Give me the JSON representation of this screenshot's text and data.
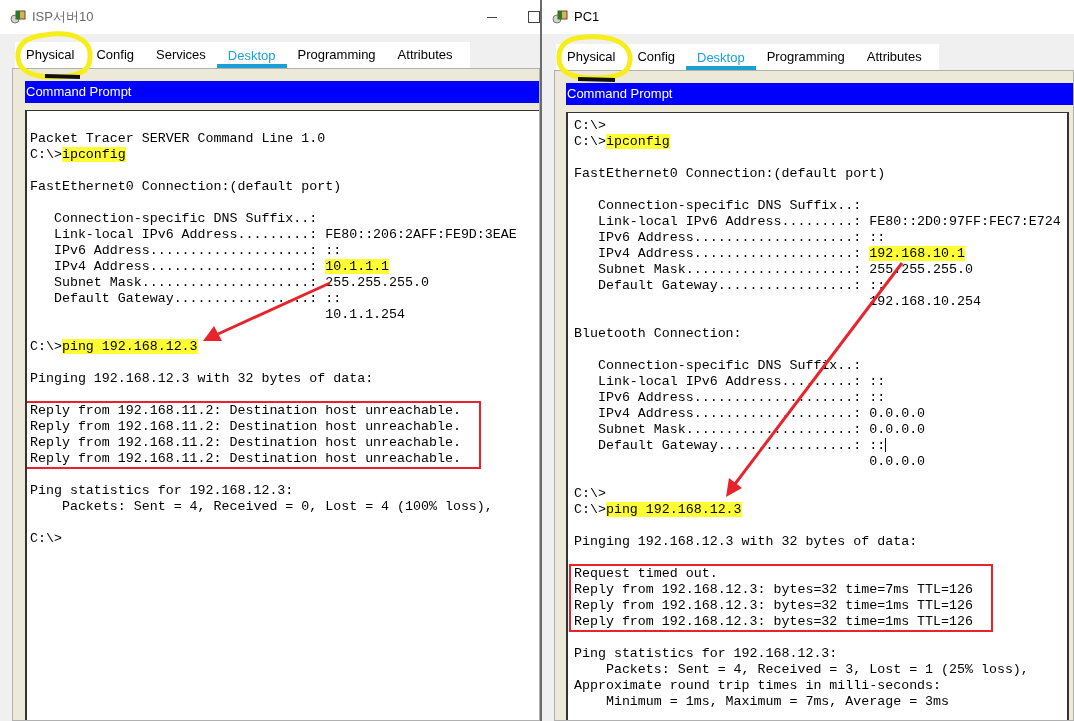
{
  "windows": [
    {
      "title": "ISP서버10",
      "active": false,
      "controls": true,
      "tabs": [
        {
          "label": "Physical",
          "selected": false
        },
        {
          "label": "Config",
          "selected": false
        },
        {
          "label": "Services",
          "selected": false
        },
        {
          "label": "Desktop",
          "selected": true
        },
        {
          "label": "Programming",
          "selected": false
        },
        {
          "label": "Attributes",
          "selected": false
        }
      ],
      "panel_title": "Command Prompt",
      "terminal": {
        "blocks": [
          {
            "boxed": false,
            "lines": [
              {
                "text": "Packet Tracer SERVER Command Line 1.0"
              },
              {
                "text": "C:\\>",
                "highlight": "ipconfig"
              }
            ]
          },
          {
            "boxed": false,
            "lines": [
              {
                "text": "FastEthernet0 Connection:(default port)"
              }
            ]
          },
          {
            "boxed": false,
            "lines": [
              {
                "text": "   Connection-specific DNS Suffix..:"
              },
              {
                "text": "   Link-local IPv6 Address.........: FE80::206:2AFF:FE9D:3EAE"
              },
              {
                "text": "   IPv6 Address....................: ::"
              },
              {
                "text": "   IPv4 Address....................: ",
                "highlight": "10.1.1.1"
              },
              {
                "text": "   Subnet Mask.....................: 255.255.255.0"
              },
              {
                "text": "   Default Gateway.................: ::"
              },
              {
                "text": "                                     10.1.1.254"
              }
            ]
          },
          {
            "boxed": false,
            "lines": [
              {
                "text": "C:\\>",
                "highlight": "ping 192.168.12.3"
              }
            ]
          },
          {
            "boxed": false,
            "lines": [
              {
                "text": "Pinging 192.168.12.3 with 32 bytes of data:"
              }
            ]
          },
          {
            "boxed": true,
            "lines": [
              {
                "text": "Reply from 192.168.11.2: Destination host unreachable."
              },
              {
                "text": "Reply from 192.168.11.2: Destination host unreachable."
              },
              {
                "text": "Reply from 192.168.11.2: Destination host unreachable."
              },
              {
                "text": "Reply from 192.168.11.2: Destination host unreachable."
              }
            ]
          },
          {
            "boxed": false,
            "lines": [
              {
                "text": "Ping statistics for 192.168.12.3:"
              },
              {
                "text": "    Packets: Sent = 4, Received = 0, Lost = 4 (100% loss),"
              }
            ]
          },
          {
            "boxed": false,
            "lines": [
              {
                "text": "C:\\>"
              }
            ]
          }
        ]
      }
    },
    {
      "title": "PC1",
      "active": true,
      "controls": false,
      "tabs": [
        {
          "label": "Physical",
          "selected": false
        },
        {
          "label": "Config",
          "selected": false
        },
        {
          "label": "Desktop",
          "selected": true
        },
        {
          "label": "Programming",
          "selected": false
        },
        {
          "label": "Attributes",
          "selected": false
        }
      ],
      "panel_title": "Command Prompt",
      "terminal": {
        "blocks": [
          {
            "boxed": false,
            "lines": [
              {
                "text": "C:\\>"
              },
              {
                "text": "C:\\>",
                "highlight": "ipconfig"
              }
            ]
          },
          {
            "boxed": false,
            "lines": [
              {
                "text": "FastEthernet0 Connection:(default port)"
              }
            ]
          },
          {
            "boxed": false,
            "lines": [
              {
                "text": "   Connection-specific DNS Suffix..:"
              },
              {
                "text": "   Link-local IPv6 Address.........: FE80::2D0:97FF:FEC7:E724"
              },
              {
                "text": "   IPv6 Address....................: ::"
              },
              {
                "text": "   IPv4 Address....................: ",
                "highlight": "192.168.10.1"
              },
              {
                "text": "   Subnet Mask.....................: 255.255.255.0"
              },
              {
                "text": "   Default Gateway.................: ::"
              },
              {
                "text": "                                     192.168.10.254"
              }
            ]
          },
          {
            "boxed": false,
            "lines": [
              {
                "text": "Bluetooth Connection:"
              }
            ]
          },
          {
            "boxed": false,
            "lines": [
              {
                "text": "   Connection-specific DNS Suffix..:"
              },
              {
                "text": "   Link-local IPv6 Address.........: ::"
              },
              {
                "text": "   IPv6 Address....................: ::"
              },
              {
                "text": "   IPv4 Address....................: 0.0.0.0"
              },
              {
                "text": "   Subnet Mask.....................: 0.0.0.0"
              },
              {
                "text": "   Default Gateway.................: ::",
                "cursor": true
              },
              {
                "text": "                                     0.0.0.0"
              }
            ]
          },
          {
            "boxed": false,
            "lines": [
              {
                "text": "C:\\>"
              },
              {
                "text": "C:\\>",
                "highlight": "ping 192.168.12.3"
              }
            ]
          },
          {
            "boxed": false,
            "lines": [
              {
                "text": "Pinging 192.168.12.3 with 32 bytes of data:"
              }
            ]
          },
          {
            "boxed": true,
            "lines": [
              {
                "text": "Request timed out."
              },
              {
                "text": "Reply from 192.168.12.3: bytes=32 time=7ms TTL=126"
              },
              {
                "text": "Reply from 192.168.12.3: bytes=32 time=1ms TTL=126"
              },
              {
                "text": "Reply from 192.168.12.3: bytes=32 time=1ms TTL=126"
              }
            ]
          },
          {
            "boxed": false,
            "lines": [
              {
                "text": "Ping statistics for 192.168.12.3:"
              },
              {
                "text": "    Packets: Sent = 4, Received = 3, Lost = 1 (25% loss),"
              },
              {
                "text": "Approximate round trip times in milli-seconds:"
              },
              {
                "text": "    Minimum = 1ms, Maximum = 7ms, Average = 3ms"
              }
            ]
          }
        ]
      }
    }
  ]
}
